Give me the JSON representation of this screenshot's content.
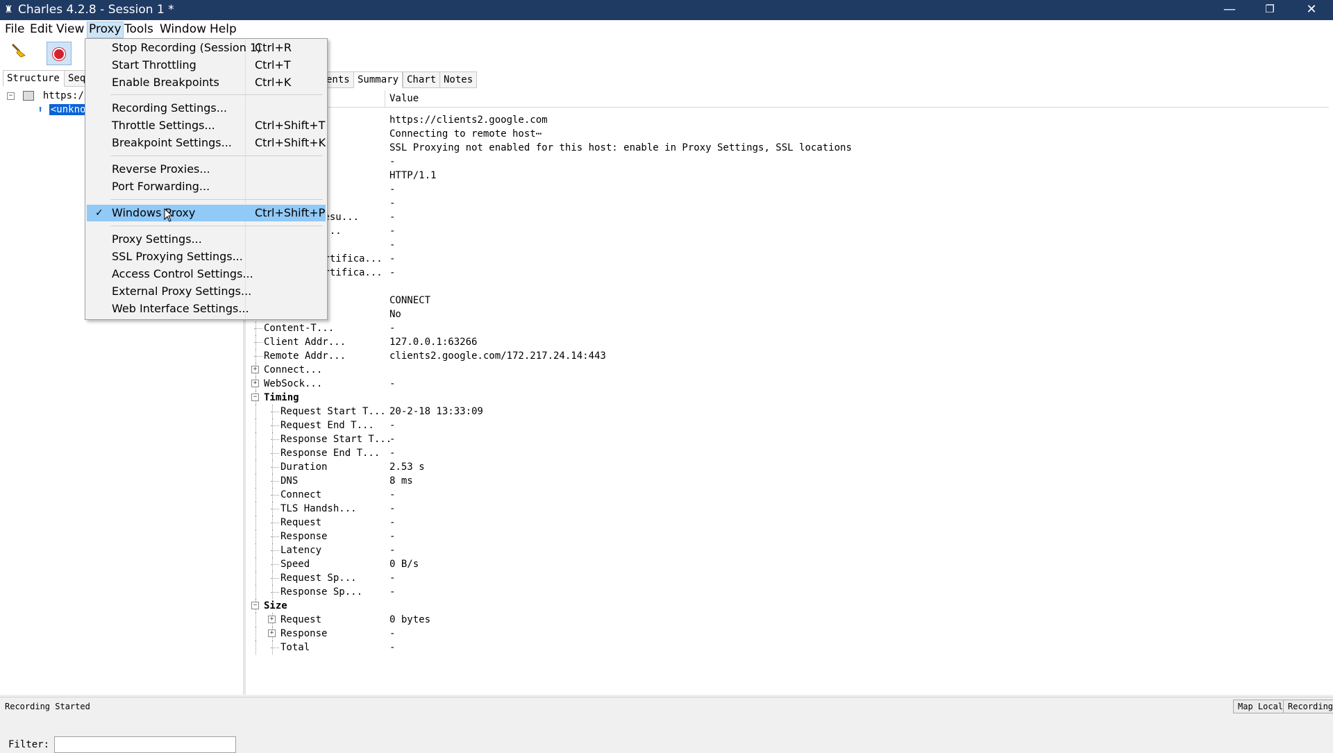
{
  "window": {
    "title": "Charles 4.2.8 - Session 1 *",
    "minimize": "—",
    "restore": "❐",
    "close": "✕"
  },
  "menubar": [
    "File",
    "Edit",
    "View",
    "Proxy",
    "Tools",
    "Window",
    "Help"
  ],
  "proxy_menu": {
    "items": [
      {
        "label": "Stop Recording (Session 1)",
        "shortcut": "Ctrl+R"
      },
      {
        "label": "Start Throttling",
        "shortcut": "Ctrl+T"
      },
      {
        "label": "Enable Breakpoints",
        "shortcut": "Ctrl+K"
      },
      {
        "label": "Recording Settings...",
        "shortcut": ""
      },
      {
        "label": "Throttle Settings...",
        "shortcut": "Ctrl+Shift+T"
      },
      {
        "label": "Breakpoint Settings...",
        "shortcut": "Ctrl+Shift+K"
      },
      {
        "label": "Reverse Proxies...",
        "shortcut": ""
      },
      {
        "label": "Port Forwarding...",
        "shortcut": ""
      },
      {
        "label": "Windows Proxy",
        "shortcut": "Ctrl+Shift+P",
        "checked": "✓"
      },
      {
        "label": "Proxy Settings...",
        "shortcut": ""
      },
      {
        "label": "SSL Proxying Settings...",
        "shortcut": ""
      },
      {
        "label": "Access Control Settings...",
        "shortcut": ""
      },
      {
        "label": "External Proxy Settings...",
        "shortcut": ""
      },
      {
        "label": "Web Interface Settings...",
        "shortcut": ""
      }
    ]
  },
  "left_panel": {
    "tabs": [
      "Structure",
      "Seq"
    ],
    "tree": [
      "https://c",
      "<unkno"
    ],
    "filter_label": "Filter:"
  },
  "right_panel": {
    "tabs": [
      "ents",
      "Summary",
      "Chart",
      "Notes"
    ],
    "columns": {
      "value": "Value"
    },
    "rows": [
      {
        "name": "",
        "value": "https://clients2.google.com"
      },
      {
        "name": "",
        "value": "Connecting to remote host⋯"
      },
      {
        "name": "",
        "value": "SSL Proxying not enabled for this host: enable in Proxy Settings, SSL locations"
      },
      {
        "name": "..",
        "value": "-"
      },
      {
        "name": "",
        "value": "HTTP/1.1"
      },
      {
        "name": "",
        "value": "-"
      },
      {
        "name": "",
        "value": "-"
      },
      {
        "name": "Resu...",
        "value": "-"
      },
      {
        "name": "u...",
        "value": "-"
      },
      {
        "name": "",
        "value": "-"
      },
      {
        "name": "ertifica...",
        "value": "-"
      },
      {
        "name": "ertifica...",
        "value": "-"
      },
      {
        "name": "..",
        "value": ""
      },
      {
        "name": "",
        "value": "CONNECT"
      },
      {
        "name": "",
        "value": "No"
      },
      {
        "name": "Content-T...",
        "value": "-"
      },
      {
        "name": "Client Addr...",
        "value": "127.0.0.1:63266"
      },
      {
        "name": "Remote Addr...",
        "value": "clients2.google.com/172.217.24.14:443"
      },
      {
        "name": "Connect...",
        "value": ""
      },
      {
        "name": "WebSock...",
        "value": "-"
      },
      {
        "name": "Timing",
        "value": ""
      },
      {
        "name": "Request Start T...",
        "value": "20-2-18 13:33:09"
      },
      {
        "name": "Request End T...",
        "value": "-"
      },
      {
        "name": "Response Start T...",
        "value": "-"
      },
      {
        "name": "Response End T...",
        "value": "-"
      },
      {
        "name": "Duration",
        "value": "2.53 s"
      },
      {
        "name": "DNS",
        "value": "8 ms"
      },
      {
        "name": "Connect",
        "value": "-"
      },
      {
        "name": "TLS Handsh...",
        "value": "-"
      },
      {
        "name": "Request",
        "value": "-"
      },
      {
        "name": "Response",
        "value": "-"
      },
      {
        "name": "Latency",
        "value": "-"
      },
      {
        "name": "Speed",
        "value": "0 B/s"
      },
      {
        "name": "Request Sp...",
        "value": "-"
      },
      {
        "name": "Response Sp...",
        "value": "-"
      },
      {
        "name": "Size",
        "value": ""
      },
      {
        "name": "Request",
        "value": "0 bytes"
      },
      {
        "name": "Response",
        "value": "-"
      },
      {
        "name": "Total",
        "value": "-"
      }
    ]
  },
  "statusbar": {
    "text": "Recording Started",
    "map_local": "Map Local",
    "recording": "Recording"
  }
}
